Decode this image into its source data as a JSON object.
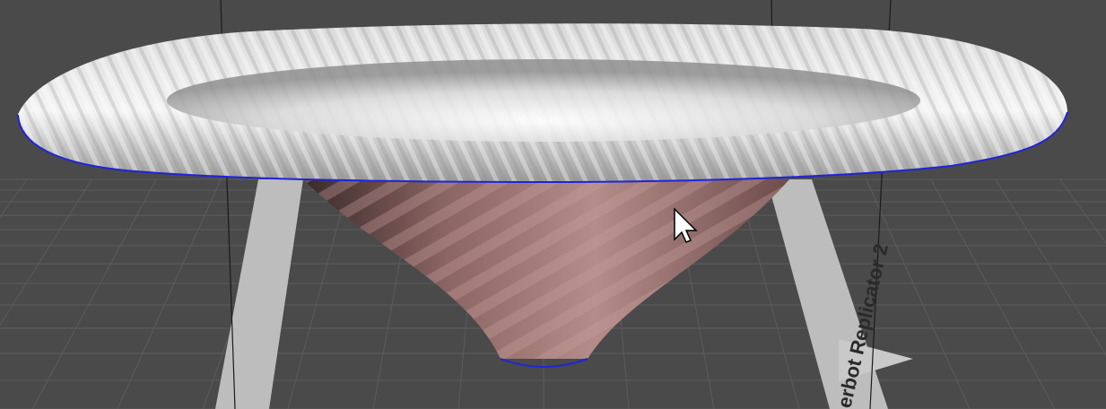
{
  "viewport": {
    "label": "3D build volume viewport",
    "background_color": "#4a4a4a",
    "grid_color": "#5c5c5c",
    "plate_border_color": "#bdbdbd"
  },
  "build_plate": {
    "printer_label": "erbot Replicator 2",
    "label_color": "#2a2a2a"
  },
  "model": {
    "name": "trumpet-bell vase",
    "rim_color": "#e6e6e6",
    "stem_color": "#a77d7b",
    "selection_outline_color": "#1f24d9"
  },
  "cursor": {
    "icon": "arrow-pointer"
  }
}
